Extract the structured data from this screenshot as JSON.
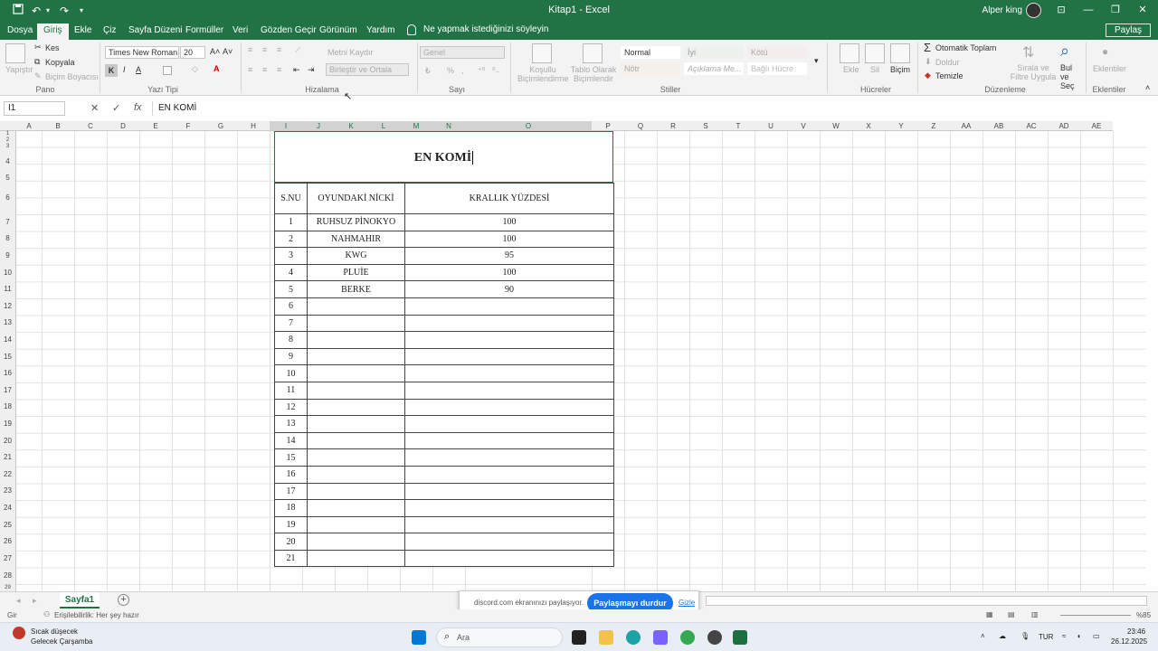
{
  "titlebar": {
    "title": "Kitap1 - Excel",
    "user": "Alper king",
    "save_icon": "save-icon",
    "undo_icon": "undo-icon",
    "redo_icon": "redo-icon"
  },
  "tabs": [
    "Dosya",
    "Giriş",
    "Ekle",
    "Çiz",
    "Sayfa Düzeni",
    "Formüller",
    "Veri",
    "Gözden Geçir",
    "Görünüm",
    "Yardım"
  ],
  "tell_me": "Ne yapmak istediğinizi söyleyin",
  "share": "Paylaş",
  "ribbon": {
    "pano": {
      "paste": "Yapıştır",
      "cut": "Kes",
      "copy": "Kopyala",
      "format_painter": "Biçim Boyacısı",
      "label": "Pano"
    },
    "font": {
      "name": "Times New Roman",
      "size": "20",
      "bold": "K",
      "italic": "I",
      "underline": "A",
      "label": "Yazı Tipi"
    },
    "align": {
      "wrap": "Metni Kaydır",
      "merge": "Birleştir ve Ortala",
      "label": "Hizalama"
    },
    "number": {
      "format": "Genel",
      "label": "Sayı"
    },
    "styles": {
      "conditional": "Koşullu Biçimlendirme",
      "table": "Tablo Olarak Biçimlendir",
      "normal": "Normal",
      "iyi": "İyi",
      "kotu": "Kötü",
      "notr": "Nötr",
      "aciklama": "Açıklama Me...",
      "bagli": "Bağlı Hücre",
      "label": "Stiller"
    },
    "cells": {
      "insert": "Ekle",
      "delete": "Sil",
      "format": "Biçim",
      "label": "Hücreler"
    },
    "editing": {
      "autosum": "Otomatik Toplam",
      "fill": "Doldur",
      "clear": "Temizle",
      "sort": "Sırala ve Filtre Uygula",
      "find": "Bul ve Seç",
      "label": "Düzenleme"
    },
    "addins": {
      "label": "Eklentiler",
      "btn": "Eklentiler"
    }
  },
  "formula_bar": {
    "namebox": "I1",
    "fx": "fx",
    "content": "EN KOMİ"
  },
  "columns": [
    "A",
    "B",
    "C",
    "D",
    "E",
    "F",
    "G",
    "H",
    "I",
    "J",
    "K",
    "L",
    "M",
    "N",
    "O",
    "P",
    "Q",
    "R",
    "S",
    "T",
    "U",
    "V",
    "W",
    "X",
    "Y",
    "Z",
    "AA",
    "AB",
    "AC",
    "AD",
    "AE"
  ],
  "rows": [
    "1",
    "2",
    "3",
    "4",
    "5",
    "6",
    "7",
    "8",
    "9",
    "10",
    "11",
    "12",
    "13",
    "14",
    "15",
    "16",
    "17",
    "18",
    "19",
    "20",
    "21",
    "22",
    "23",
    "24",
    "25",
    "26",
    "27",
    "28",
    "29"
  ],
  "sheet": {
    "title": "EN KOMİ",
    "headers": [
      "S.NU",
      "OYUNDAKİ NİCKİ",
      "KRALLIK YÜZDESİ"
    ],
    "rows": [
      [
        "1",
        "RUHSUZ PİNOKYO",
        "100"
      ],
      [
        "2",
        "NAHMAHIR",
        "100"
      ],
      [
        "3",
        "KWG",
        "95"
      ],
      [
        "4",
        "PLUİE",
        "100"
      ],
      [
        "5",
        "BERKE",
        "90"
      ],
      [
        "6",
        "",
        ""
      ],
      [
        "7",
        "",
        ""
      ],
      [
        "8",
        "",
        ""
      ],
      [
        "9",
        "",
        ""
      ],
      [
        "10",
        "",
        ""
      ],
      [
        "11",
        "",
        ""
      ],
      [
        "12",
        "",
        ""
      ],
      [
        "13",
        "",
        ""
      ],
      [
        "14",
        "",
        ""
      ],
      [
        "15",
        "",
        ""
      ],
      [
        "16",
        "",
        ""
      ],
      [
        "17",
        "",
        ""
      ],
      [
        "18",
        "",
        ""
      ],
      [
        "19",
        "",
        ""
      ],
      [
        "20",
        "",
        ""
      ],
      [
        "21",
        "",
        ""
      ]
    ]
  },
  "sheet_tab": "Sayfa1",
  "share_popup": {
    "message": "discord.com ekranınızı paylaşıyor.",
    "stop": "Paylaşmayı durdur",
    "hide": "Gizle"
  },
  "status": {
    "mode": "Gir",
    "accessibility": "Erişilebilirlik: Her şey hazır",
    "zoom": "%85"
  },
  "taskbar": {
    "weather_title": "Sıcak düşecek",
    "weather_sub": "Gelecek Çarşamba",
    "search": "Ara",
    "lang": "TUR",
    "time": "23:46",
    "date": "26.12.2025"
  }
}
